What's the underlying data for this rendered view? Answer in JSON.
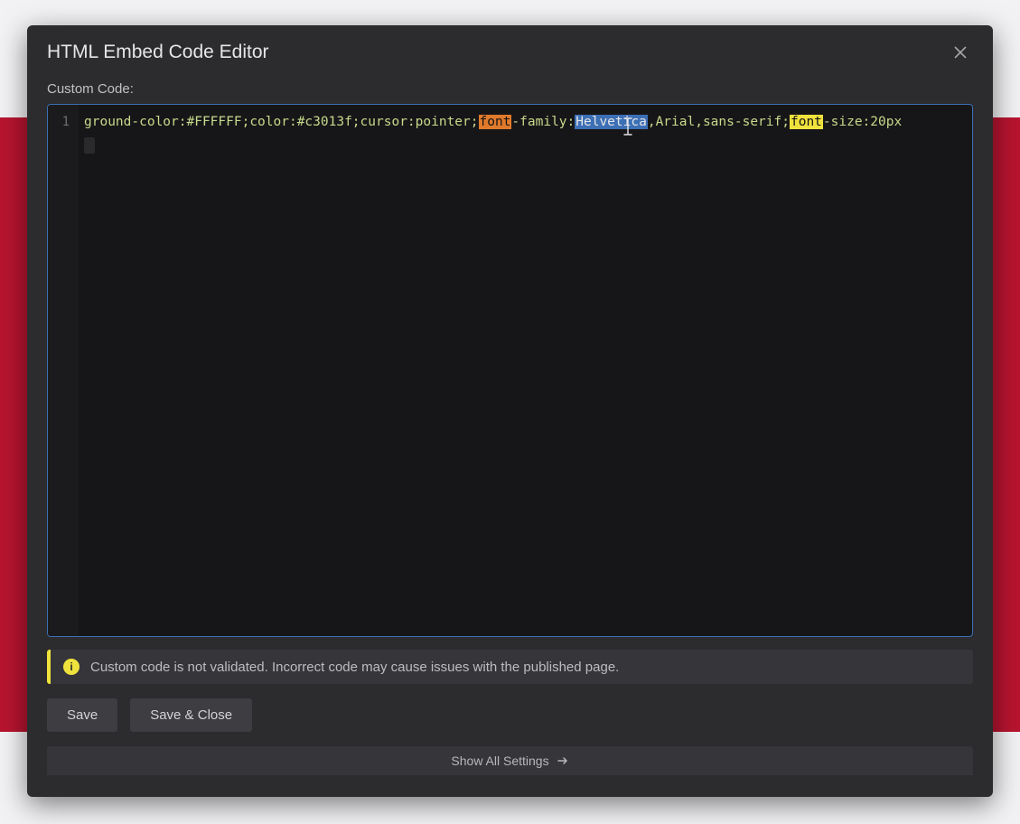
{
  "modal": {
    "title": "HTML Embed Code Editor",
    "fieldLabel": "Custom Code:",
    "lineNumber": "1",
    "code": {
      "seg1": "ground-color:#FFFFFF;color:#c3013f;cursor:pointer;",
      "fontHl1": "font",
      "seg2": "-family:",
      "helveticaHl": "Helvetica",
      "seg3": ",Arial,sans-serif;",
      "fontHl2": "font",
      "seg4": "-size:20px"
    },
    "warning": "Custom code is not validated. Incorrect code may cause issues with the published page.",
    "buttons": {
      "save": "Save",
      "saveClose": "Save & Close"
    },
    "showAll": "Show All Settings"
  }
}
